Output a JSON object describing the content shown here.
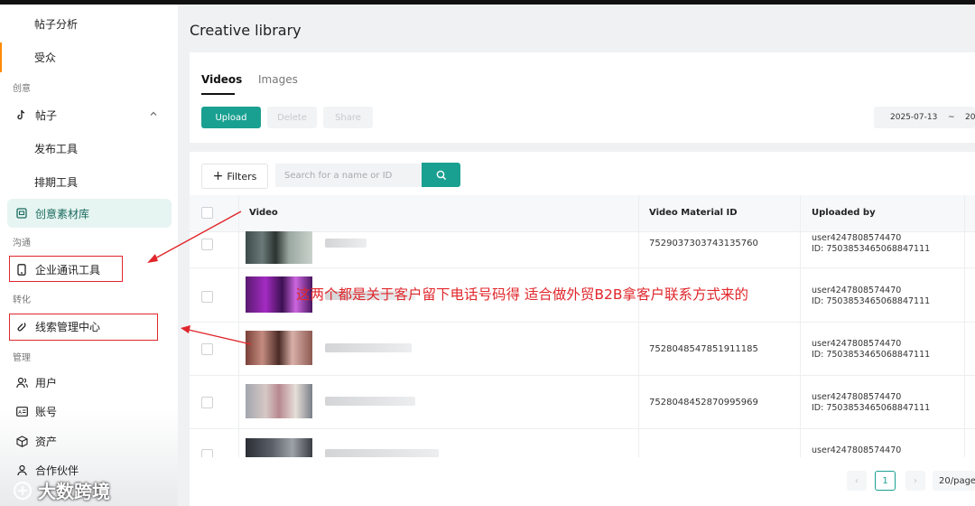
{
  "sidebar": {
    "items": {
      "post_analysis": "帖子分析",
      "audience": "受众",
      "group_creative": "创意",
      "posts": "帖子",
      "publish_tool": "发布工具",
      "schedule_tool": "排期工具",
      "creative_library": "创意素材库",
      "group_communication": "沟通",
      "business_messaging": "企业通讯工具",
      "group_conversion": "转化",
      "leads_center": "线索管理中心",
      "group_management": "管理",
      "users": "用户",
      "account": "账号",
      "assets": "资产",
      "partners": "合作伙伴"
    }
  },
  "page": {
    "title": "Creative library"
  },
  "tabs": [
    {
      "label": "Videos",
      "active": true
    },
    {
      "label": "Images",
      "active": false
    }
  ],
  "actions": {
    "upload": "Upload",
    "delete": "Delete",
    "share": "Share"
  },
  "date_range": {
    "start": "2025-07-13",
    "separator": "~",
    "end": "20"
  },
  "filters": {
    "label": "Filters",
    "search_placeholder": "Search for a name or ID"
  },
  "table": {
    "headers": {
      "video": "Video",
      "material_id": "Video Material ID",
      "uploaded_by": "Uploaded by"
    },
    "rows": [
      {
        "material_id": "7529037303743135760",
        "user": "user4247808574470",
        "uid": "ID: 7503853465068847111"
      },
      {
        "material_id": "",
        "user": "user4247808574470",
        "uid": "ID: 7503853465068847111"
      },
      {
        "material_id": "7528048547851911185",
        "user": "user4247808574470",
        "uid": "ID: 7503853465068847111"
      },
      {
        "material_id": "7528048452870995969",
        "user": "user4247808574470",
        "uid": "ID: 7503853465068847111"
      },
      {
        "material_id": "",
        "user": "user4247808574470",
        "uid": ""
      }
    ]
  },
  "annotation": "这两个都是关于客户留下电话号码得 适合做外贸B2B拿客户联系方式来的",
  "pagination": {
    "current": "1",
    "page_size": "20/page"
  },
  "watermark": "大数跨境",
  "colors": {
    "accent": "#1aa091",
    "annotation": "#e0262b",
    "sidebar_active_bg": "#e7f5f2"
  }
}
